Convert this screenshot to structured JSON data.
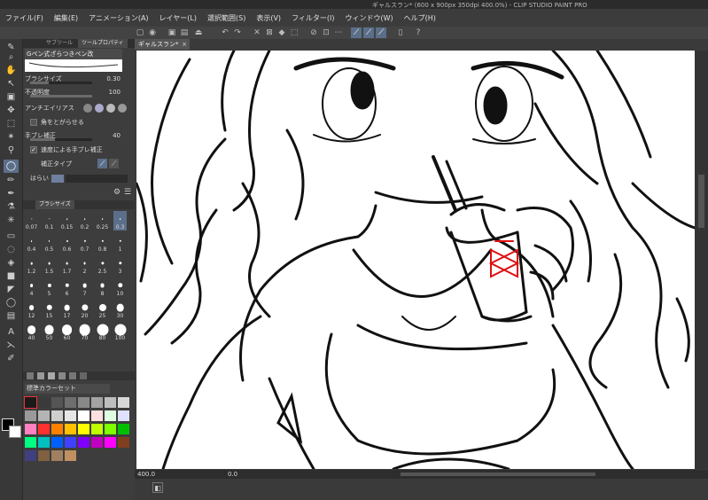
{
  "window": {
    "title": "ギャルスラン* (600 x 900px 350dpi 400.0%) - CLIP STUDIO PAINT PRO"
  },
  "menu": [
    "ファイル(F)",
    "編集(E)",
    "アニメーション(A)",
    "レイヤー(L)",
    "選択範囲(S)",
    "表示(V)",
    "フィルター(I)",
    "ウィンドウ(W)",
    "ヘルプ(H)"
  ],
  "tool_panel": {
    "tabs": [
      "サブツール",
      "ツールプロパティ"
    ],
    "brush_name": "Gペン式ざらつきペン改",
    "properties": {
      "brush_size_label": "ブラシサイズ",
      "brush_size_value": "0.30",
      "opacity_label": "不透明度",
      "opacity_value": "100",
      "antialias_label": "アンチエイリアス",
      "sharpen_label": "角をとがらせる",
      "stabilization_label": "手ブレ補正",
      "stabilization_value": "40",
      "speed_stab_label": "速度による手ブレ補正",
      "correction_type_label": "補正タイプ",
      "sweep_label": "はらい"
    },
    "brush_size_pct": 0.3,
    "opacity_pct": 1.0,
    "stabilization_pct": 0.4
  },
  "brush_size_panel": {
    "tab": "ブラシサイズ",
    "sizes": [
      "0.07",
      "0.1",
      "0.15",
      "0.2",
      "0.25",
      "0.3",
      "0.4",
      "0.5",
      "0.6",
      "0.7",
      "0.8",
      "1",
      "1.2",
      "1.5",
      "1.7",
      "2",
      "2.5",
      "3",
      "4",
      "5",
      "6",
      "7",
      "8",
      "10",
      "12",
      "15",
      "17",
      "20",
      "25",
      "30",
      "40",
      "50",
      "60",
      "70",
      "80",
      "100"
    ],
    "selected": "0.3"
  },
  "color_set": {
    "name": "標準カラーセット",
    "swatches": [
      "#1a1a1a",
      "#3a3a3a",
      "#555555",
      "#6e6e6e",
      "#888888",
      "#a3a3a3",
      "#bebebe",
      "#d8d8d8",
      "#9a9a9a",
      "#b4b4b4",
      "#cecece",
      "#e6e6e6",
      "#ffffff",
      "#ffe0e0",
      "#e0ffe0",
      "#e0e0ff",
      "#ff80c0",
      "#ff3030",
      "#ff8000",
      "#ffc000",
      "#ffff00",
      "#c0ff00",
      "#80ff00",
      "#00c000",
      "#00ff80",
      "#00c0c0",
      "#0060ff",
      "#4040ff",
      "#8000ff",
      "#c000c0",
      "#ff00ff",
      "#804020",
      "#404080",
      "#806040",
      "#a08060",
      "#c09060"
    ]
  },
  "canvas": {
    "tab_label": "ギャルスラン*",
    "zoom": "400.0",
    "angle": "0.0"
  },
  "accent_color": "#5b6f8a"
}
